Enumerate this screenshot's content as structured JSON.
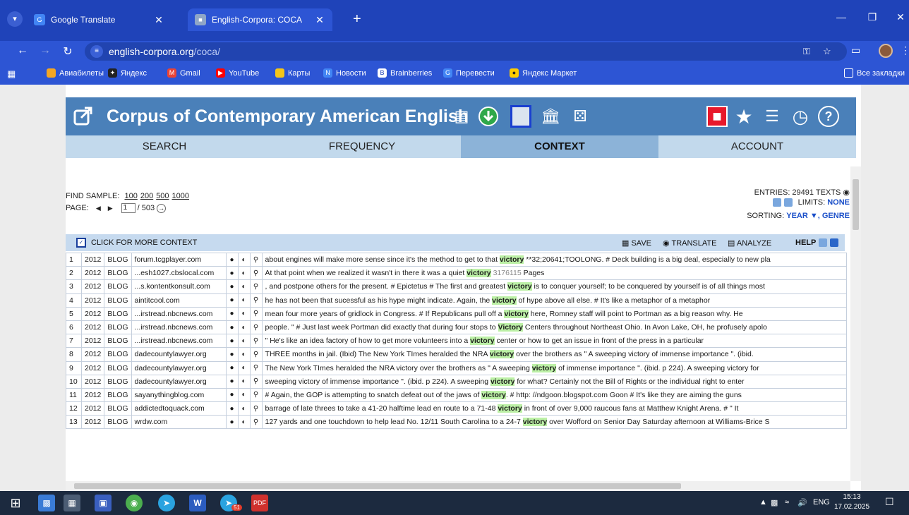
{
  "browser": {
    "tabs": [
      {
        "title": "Google Translate",
        "favicon": "google-translate-icon",
        "active": false
      },
      {
        "title": "English-Corpora: COCA",
        "favicon": "corpus-page-icon",
        "active": true
      }
    ],
    "url_host": "english-corpora.org",
    "url_path": "/coca/",
    "bookmarks": [
      {
        "label": "Авиабилеты",
        "icon": "plane-tickets-icon",
        "color": "#f5a623"
      },
      {
        "label": "Яндекс",
        "icon": "yandex-icon",
        "color": "#222222"
      },
      {
        "label": "Gmail",
        "icon": "gmail-icon",
        "color": "#ea4335"
      },
      {
        "label": "YouTube",
        "icon": "youtube-icon",
        "color": "#ff0000"
      },
      {
        "label": "Карты",
        "icon": "maps-icon",
        "color": "#f5c518"
      },
      {
        "label": "Новости",
        "icon": "news-icon",
        "color": "#4285f4"
      },
      {
        "label": "Brainberries",
        "icon": "brainberries-icon",
        "color": "#1f43b9"
      },
      {
        "label": "Перевести",
        "icon": "translate-icon",
        "color": "#4285f4"
      },
      {
        "label": "Яндекс Маркет",
        "icon": "yandex-market-icon",
        "color": "#ffcc00"
      }
    ],
    "all_bookmarks": "Все закладки"
  },
  "corpus": {
    "title": "Corpus of Contemporary American English",
    "tabs": [
      "SEARCH",
      "FREQUENCY",
      "CONTEXT",
      "ACCOUNT"
    ],
    "selected_tab": "CONTEXT",
    "find_sample_label": "FIND SAMPLE:",
    "sample_options": [
      "100",
      "200",
      "500",
      "1000"
    ],
    "page_label": "PAGE:",
    "page_current": "1",
    "page_total": "/ 503",
    "entries": "ENTRIES: 29491",
    "texts": "TEXTS",
    "limits_label": "LIMITS:",
    "limits_value": "NONE",
    "sorting_label": "SORTING:",
    "sorting_value": "YEAR ▼, GENRE",
    "more_context": "CLICK FOR MORE CONTEXT",
    "save": "SAVE",
    "translate": "TRANSLATE",
    "analyze": "ANALYZE",
    "help": "HELP",
    "rows": [
      {
        "n": "1",
        "year": "2012",
        "genre": "BLOG",
        "source": "forum.tcgplayer.com",
        "pre": "about engines will make more sense since it's the method to get to that ",
        "kw": "victory",
        "post": " **32;20641;TOOLONG. # Deck building is a big deal, especially to new pla",
        "grey": ""
      },
      {
        "n": "2",
        "year": "2012",
        "genre": "BLOG",
        "source": "...esh1027.cbslocal.com",
        "pre": "At that point when we realized it wasn't in there it was a quiet ",
        "kw": "victory",
        "post": " ",
        "grey": "3176115",
        "post2": " Pages"
      },
      {
        "n": "3",
        "year": "2012",
        "genre": "BLOG",
        "source": "...s.kontentkonsult.com",
        "pre": ", and postpone others for the present. # Epictetus # The first and greatest ",
        "kw": "victory",
        "post": " is to conquer yourself; to be conquered by yourself is of all things most",
        "grey": ""
      },
      {
        "n": "4",
        "year": "2012",
        "genre": "BLOG",
        "source": "aintitcool.com",
        "pre": "he has not been that sucessful as his hype might indicate. Again, the ",
        "kw": "victory",
        "post": " of hype above all else. # It's like a metaphor of a metaphor",
        "grey": ""
      },
      {
        "n": "5",
        "year": "2012",
        "genre": "BLOG",
        "source": "...irstread.nbcnews.com",
        "pre": "mean four more years of gridlock in Congress. # If Republicans pull off a ",
        "kw": "victory",
        "post": " here, Romney staff will point to Portman as a big reason why. He",
        "grey": ""
      },
      {
        "n": "6",
        "year": "2012",
        "genre": "BLOG",
        "source": "...irstread.nbcnews.com",
        "pre": "people. \" # Just last week Portman did exactly that during four stops to ",
        "kw": "Victory",
        "post": " Centers throughout Northeast Ohio. In Avon Lake, OH, he profusely apolo",
        "grey": ""
      },
      {
        "n": "7",
        "year": "2012",
        "genre": "BLOG",
        "source": "...irstread.nbcnews.com",
        "pre": "\" He's like an idea factory of how to get more volunteers into a ",
        "kw": "victory",
        "post": " center or how to get an issue in front of the press in a particular",
        "grey": ""
      },
      {
        "n": "8",
        "year": "2012",
        "genre": "BLOG",
        "source": "dadecountylawyer.org",
        "pre": "THREE months in jail. (Ibid) The New York TImes heralded the NRA ",
        "kw": "victory",
        "post": " over the brothers as \" A sweeping victory of immense importance \". (ibid.",
        "grey": ""
      },
      {
        "n": "9",
        "year": "2012",
        "genre": "BLOG",
        "source": "dadecountylawyer.org",
        "pre": "The New York TImes heralded the NRA victory over the brothers as \" A sweeping ",
        "kw": "victory",
        "post": " of immense importance \". (ibid. p 224). A sweeping victory for",
        "grey": ""
      },
      {
        "n": "10",
        "year": "2012",
        "genre": "BLOG",
        "source": "dadecountylawyer.org",
        "pre": "sweeping victory of immense importance \". (ibid. p 224). A sweeping ",
        "kw": "victory",
        "post": " for what? Certainly not the Bill of Rights or the individual right to enter",
        "grey": ""
      },
      {
        "n": "11",
        "year": "2012",
        "genre": "BLOG",
        "source": "sayanythingblog.com",
        "pre": "# Again, the GOP is attempting to snatch defeat out of the jaws of ",
        "kw": "victory",
        "post": ". # http: //ndgoon.blogspot.com Goon # It's like they are aiming the guns",
        "grey": ""
      },
      {
        "n": "12",
        "year": "2012",
        "genre": "BLOG",
        "source": "addictedtoquack.com",
        "pre": "barrage of late threes to take a 41-20 halftime lead en route to a 71-48 ",
        "kw": "victory",
        "post": " in front of over 9,000 raucous fans at Matthew Knight Arena. # \" It",
        "grey": ""
      },
      {
        "n": "13",
        "year": "2012",
        "genre": "BLOG",
        "source": "wrdw.com",
        "pre": "127 yards and one touchdown to help lead No. 12/11 South Carolina to a 24-7 ",
        "kw": "victory",
        "post": " over Wofford on Senior Day Saturday afternoon at Williams-Brice S",
        "grey": ""
      }
    ]
  },
  "taskbar": {
    "language": "ENG",
    "time": "15:13",
    "date": "17.02.2025",
    "badge": "51"
  },
  "colors": {
    "chrome": "#1f43b9",
    "banner": "#4a80b9",
    "tab_bg": "#c2d9ec",
    "tab_selected": "#8cb3d8",
    "keyword_highlight": "#bcf0a6"
  }
}
